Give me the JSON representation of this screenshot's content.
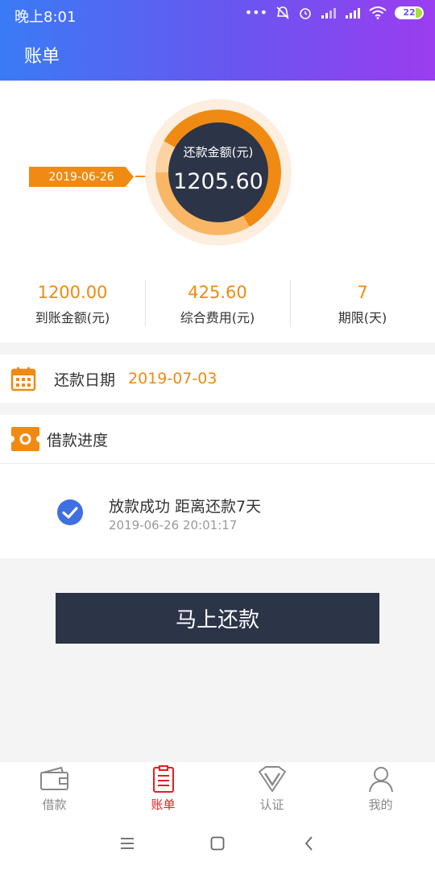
{
  "status_bar": {
    "time": "晚上8:01",
    "battery": "22"
  },
  "header": {
    "title": "账单"
  },
  "summary": {
    "date_tag": "2019-06-26",
    "ring_label": "还款金额(元)",
    "ring_amount": "1205.60",
    "stats": [
      {
        "value": "1200.00",
        "label": "到账金额(元)"
      },
      {
        "value": "425.60",
        "label": "综合费用(元)"
      },
      {
        "value": "7",
        "label": "期限(天)"
      }
    ]
  },
  "repay_date": {
    "label": "还款日期",
    "value": "2019-07-03"
  },
  "progress": {
    "title": "借款进度",
    "event": {
      "title": "放款成功 距离还款7天",
      "time": "2019-06-26 20:01:17"
    }
  },
  "repay_button": "马上还款",
  "tabs": [
    {
      "label": "借款",
      "icon": "wallet-icon",
      "active": false
    },
    {
      "label": "账单",
      "icon": "bill-icon",
      "active": true
    },
    {
      "label": "认证",
      "icon": "certify-icon",
      "active": false
    },
    {
      "label": "我的",
      "icon": "user-icon",
      "active": false
    }
  ],
  "colors": {
    "accent": "#f08a12",
    "dark": "#2c3448",
    "active_tab": "#e02020",
    "check": "#3f6fe0"
  }
}
